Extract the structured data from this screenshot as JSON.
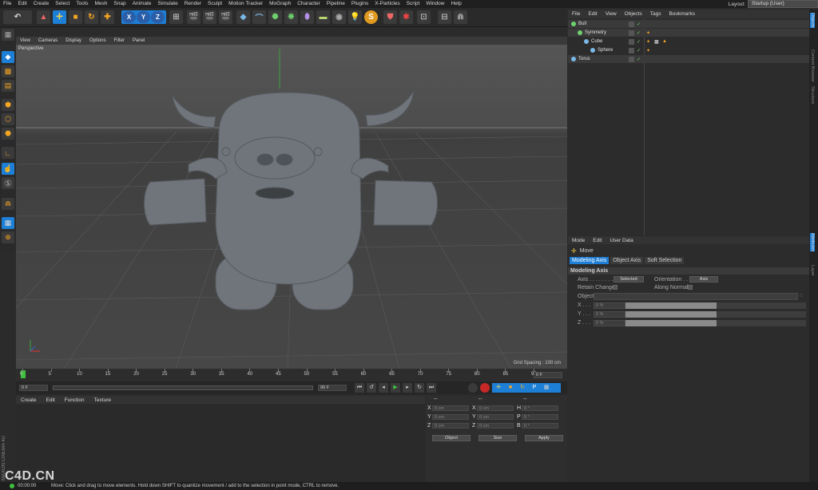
{
  "menu": [
    "File",
    "Edit",
    "Create",
    "Select",
    "Tools",
    "Mesh",
    "Snap",
    "Animate",
    "Simulate",
    "Render",
    "Sculpt",
    "Motion Tracker",
    "MoGraph",
    "Character",
    "Pipeline",
    "Plugins",
    "X-Particles",
    "Script",
    "Window",
    "Help"
  ],
  "layout": {
    "label": "Layout:",
    "value": "Startup (User)"
  },
  "toolbar": {
    "x": "X",
    "y": "Y",
    "z": "Z"
  },
  "viewport": {
    "menu": [
      "View",
      "Cameras",
      "Display",
      "Options",
      "Filter",
      "Panel"
    ],
    "label": "Perspective",
    "grid_spacing": "Grid Spacing : 100 cm"
  },
  "timeline": {
    "ticks": [
      "0",
      "5",
      "10",
      "15",
      "20",
      "25",
      "30",
      "35",
      "40",
      "45",
      "50",
      "55",
      "60",
      "65",
      "70",
      "75",
      "80",
      "85",
      "90"
    ],
    "current": "0 F",
    "start": "0 F",
    "end": "90 F"
  },
  "material": {
    "menu": [
      "Create",
      "Edit",
      "Function",
      "Texture"
    ]
  },
  "coords": {
    "headers": [
      "--",
      "--",
      "--"
    ],
    "rows": [
      {
        "a": "X",
        "av": "0 cm",
        "b": "X",
        "bv": "0 cm",
        "c": "H",
        "cv": "0 °"
      },
      {
        "a": "Y",
        "av": "0 cm",
        "b": "Y",
        "bv": "0 cm",
        "c": "P",
        "cv": "0 °"
      },
      {
        "a": "Z",
        "av": "0 cm",
        "b": "Z",
        "bv": "0 cm",
        "c": "B",
        "cv": "0 °"
      }
    ],
    "mode1": "Object",
    "mode2": "Size",
    "apply": "Apply"
  },
  "objects": {
    "menu": [
      "File",
      "Edit",
      "View",
      "Objects",
      "Tags",
      "Bookmarks"
    ],
    "items": [
      {
        "name": "Bull",
        "indent": 0,
        "color": "#6fd16f"
      },
      {
        "name": "Symmetry",
        "indent": 1,
        "color": "#6fd16f"
      },
      {
        "name": "Cube",
        "indent": 2,
        "color": "#7ab8e6"
      },
      {
        "name": "Sphere",
        "indent": 3,
        "color": "#7ab8e6"
      },
      {
        "name": "Torus",
        "indent": 0,
        "color": "#7ab8e6"
      }
    ]
  },
  "attributes": {
    "menu": [
      "Mode",
      "Edit",
      "User Data"
    ],
    "tool": "Move",
    "tabs": [
      "Modeling Axis",
      "Object Axis",
      "Soft Selection"
    ],
    "section": "Modeling Axis",
    "axis_label": "Axis . . . . . . . . .",
    "axis_value": "Selected",
    "orientation_label": "Orientation . . .",
    "orientation_value": "Axis",
    "retain_label": "Retain Changes",
    "align_label": "Along Normals",
    "object_label": "Object",
    "x_label": "X . . .",
    "y_label": "Y . . .",
    "z_label": "Z . . .",
    "x_value": "0 %",
    "y_value": "0 %",
    "z_value": "0 %"
  },
  "right_tabs": [
    "Objects",
    "Content Browser",
    "Structure",
    "Attributes",
    "Layer"
  ],
  "status": {
    "time": "00:00:00",
    "message": "Move: Click and drag to move elements. Hold down SHIFT to quantize movement / add to the selection in point mode, CTRL to remove."
  },
  "branding": {
    "side": "MAXON CINEMA 4D",
    "watermark": "C4D.CN"
  },
  "colors": {
    "accent": "#1e7fd6",
    "highlight": "#3f8ee0",
    "background": "#2b2b2b"
  }
}
